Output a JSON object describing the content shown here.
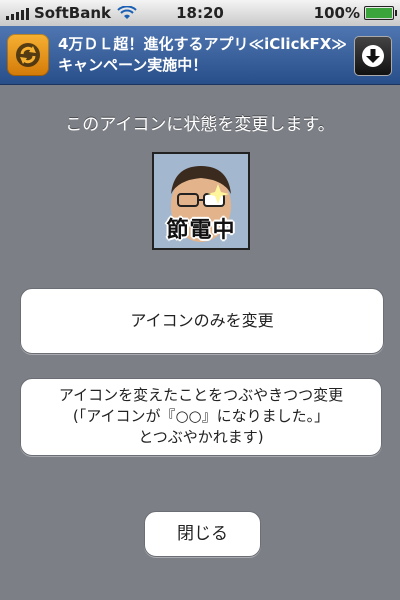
{
  "status_bar": {
    "carrier": "SoftBank",
    "time": "18:20",
    "battery_percent": "100%",
    "battery_color": "#3ba53b"
  },
  "banner": {
    "text": "4万ＤＬ超！進化するアプリ≪iClickFX≫キャンペーン実施中！",
    "app_icon": "refresh-arrows-icon",
    "download_icon": "download-arrow-icon"
  },
  "main": {
    "instruction": "このアイコンに状態を変更します。",
    "preview_icon_label": "節電中",
    "buttons": {
      "icon_only": "アイコンのみを変更",
      "change_and_tweet_line1": "アイコンを変えたことをつぶやきつつ変更",
      "change_and_tweet_line2": "(「アイコンが『○○』になりました。」",
      "change_and_tweet_line3": "とつぶやかれます)",
      "close": "閉じる"
    }
  }
}
